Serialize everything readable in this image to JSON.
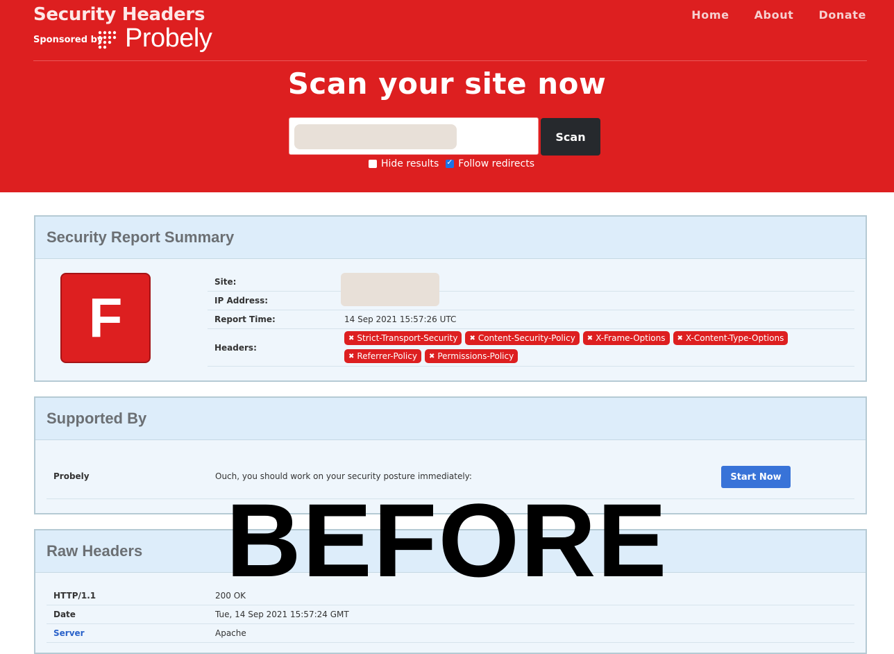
{
  "header": {
    "brand_title": "Security Headers",
    "sponsored_by": "Sponsored by",
    "sponsor_name": "Probely",
    "nav": [
      {
        "label": "Home"
      },
      {
        "label": "About"
      },
      {
        "label": "Donate"
      }
    ],
    "heading": "Scan your site now",
    "scan_label": "Scan",
    "hide_results_label": "Hide results",
    "hide_results_checked": false,
    "follow_redirects_label": "Follow redirects",
    "follow_redirects_checked": true
  },
  "summary": {
    "title": "Security Report Summary",
    "grade": "F",
    "rows": {
      "site_label": "Site:",
      "ip_label": "IP Address:",
      "report_time_label": "Report Time:",
      "report_time_value": "14 Sep 2021 15:57:26 UTC",
      "headers_label": "Headers:"
    },
    "missing_headers": [
      "Strict-Transport-Security",
      "Content-Security-Policy",
      "X-Frame-Options",
      "X-Content-Type-Options",
      "Referrer-Policy",
      "Permissions-Policy"
    ]
  },
  "supported_by": {
    "title": "Supported By",
    "name": "Probely",
    "message": "Ouch, you should work on your security posture immediately:",
    "button_label": "Start Now"
  },
  "raw_headers": {
    "title": "Raw Headers",
    "rows": [
      {
        "key": "HTTP/1.1",
        "value": "200 OK"
      },
      {
        "key": "Date",
        "value": "Tue, 14 Sep 2021 15:57:24 GMT"
      },
      {
        "key": "Server",
        "value": "Apache"
      }
    ]
  },
  "overlay_text": "BEFORE",
  "colors": {
    "brand_red": "#dd1f20",
    "dark_button": "#26292d",
    "accent_blue": "#3873d8",
    "panel_bg": "#eff6fc"
  }
}
